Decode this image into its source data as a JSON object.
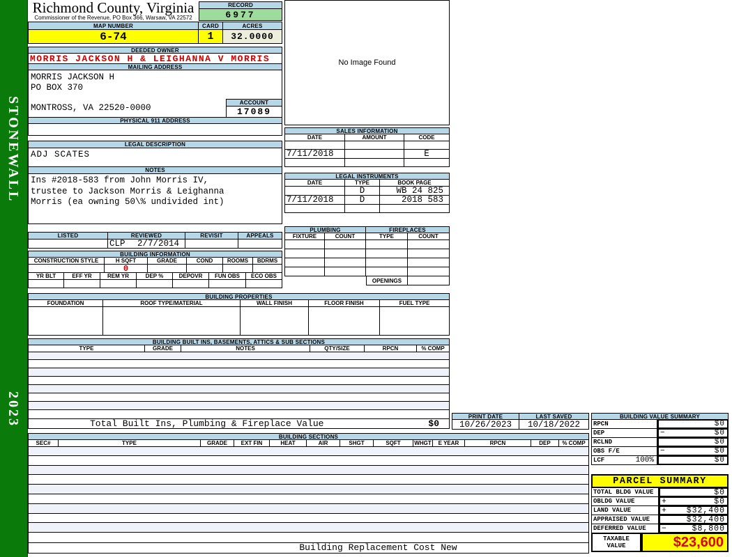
{
  "colors": {
    "sidebar_green": "#0a7b0a",
    "section_header_blue": "#b5d7e8",
    "record_green": "#9ddc9d",
    "highlight_yellow": "#ffff00",
    "acres_cream": "#eeeedd",
    "alert_red": "#cc0000",
    "taxable_red": "#e00000",
    "row_stripe": "#f0f2fa"
  },
  "sidebar": {
    "district": "STONEWALL",
    "year": "2023"
  },
  "header": {
    "county": "Richmond County, Virginia",
    "commissioner_line": "Commissioner of the Revenue, PO Box 366, Warsaw, VA 22572",
    "record_label": "RECORD",
    "record_number": "6977",
    "map_number_label": "MAP NUMBER",
    "map_number": "6-74",
    "card_label": "CARD",
    "card": "1",
    "acres_label": "ACRES",
    "acres": "32.0000"
  },
  "owner": {
    "deeded_owner_label": "DEEDED OWNER",
    "deeded_owner": "MORRIS JACKSON H & LEIGHANNA V MORRIS",
    "mailing_address_label": "MAILING ADDRESS",
    "mailing_lines": [
      "MORRIS JACKSON H",
      "PO BOX 370",
      "MONTROSS, VA 22520-0000"
    ],
    "account_label": "ACCOUNT",
    "account": "17089",
    "physical_address_label": "PHYSICAL 911 ADDRESS"
  },
  "legal": {
    "description_label": "LEGAL DESCRIPTION",
    "description": "ADJ SCATES",
    "notes_label": "NOTES",
    "notes_lines": [
      "Ins #2018-583 from John Morris IV,",
      "trustee to Jackson Morris & Leighanna",
      "Morris (ea owning 50\\% undivided int)"
    ]
  },
  "review": {
    "cols": [
      "LISTED",
      "REVIEWED",
      "REVISIT",
      "APPEALS"
    ],
    "reviewed_by": "CLP",
    "reviewed_date": "2/7/2014"
  },
  "building_information": {
    "title": "BUILDING INFORMATION",
    "cols_row1": [
      "CONSTRUCTION STYLE",
      "H SQFT",
      "GRADE",
      "COND",
      "ROOMS",
      "BDRMS"
    ],
    "h_sqft": "0",
    "cols_row2": [
      "YR BLT",
      "EFF YR",
      "REM YR",
      "DEP %",
      "DEPOVR",
      "FUN OBS",
      "ECO OBS"
    ]
  },
  "image_panel": {
    "placeholder": "No Image Found"
  },
  "sales": {
    "title": "SALES INFORMATION",
    "cols": [
      "DATE",
      "AMOUNT",
      "CODE"
    ],
    "rows": [
      [
        "",
        "",
        ""
      ],
      [
        "7/11/2018",
        "",
        "E"
      ],
      [
        "",
        "",
        ""
      ]
    ]
  },
  "instruments": {
    "title": "LEGAL INSTRUMENTS",
    "cols": [
      "DATE",
      "TYPE",
      "BOOK PAGE"
    ],
    "rows": [
      [
        "",
        "D",
        "WB 24 825"
      ],
      [
        "7/11/2018",
        "D",
        "2018 583"
      ],
      [
        "",
        "",
        ""
      ]
    ]
  },
  "plumbing": {
    "title": "PLUMBING",
    "cols": [
      "FIXTURE",
      "COUNT"
    ]
  },
  "fireplaces": {
    "title": "FIREPLACES",
    "cols": [
      "TYPE",
      "COUNT"
    ],
    "openings_label": "OPENINGS"
  },
  "building_properties": {
    "title": "BUILDING PROPERTIES",
    "cols": [
      "FOUNDATION",
      "ROOF TYPE/MATERIAL",
      "WALL FINISH",
      "FLOOR FINISH",
      "FUEL TYPE"
    ]
  },
  "built_ins": {
    "title": "BUILDING BUILT INS, BASEMENTS, ATTICS & SUB SECTIONS",
    "cols": [
      "TYPE",
      "GRADE",
      "NOTES",
      "QTY/SIZE",
      "RPCN",
      "% COMP"
    ],
    "total_label": "Total Built Ins, Plumbing & Fireplace Value",
    "total_value": "$0"
  },
  "print_info": {
    "print_date_label": "PRINT DATE",
    "print_date": "10/26/2023",
    "last_saved_label": "LAST SAVED",
    "last_saved": "10/18/2022"
  },
  "building_value_summary": {
    "title": "BUILDING VALUE SUMMARY",
    "rows": [
      {
        "label": "RPCN",
        "op": "",
        "value": "$0"
      },
      {
        "label": "DEP",
        "op": "−",
        "value": "$0"
      },
      {
        "label": "RCLND",
        "op": "",
        "value": "$0"
      },
      {
        "label": "OBS F/E",
        "op": "−",
        "value": "$0"
      },
      {
        "label": "LCF",
        "pct": "100%",
        "op": "",
        "value": "$0"
      }
    ]
  },
  "building_sections": {
    "title": "BUILDING SECTIONS",
    "cols": [
      "SEC#",
      "TYPE",
      "GRADE",
      "EXT FIN",
      "HEAT",
      "AIR",
      "SHGT",
      "SQFT",
      "WHGT",
      "E YEAR",
      "RPCN",
      "DEP",
      "% COMP"
    ],
    "footer": "Building Replacement Cost New"
  },
  "parcel_summary": {
    "title": "PARCEL SUMMARY",
    "rows": [
      {
        "label": "TOTAL BLDG VALUE",
        "op": "",
        "value": "$0"
      },
      {
        "label": "OBLDG VALUE",
        "op": "+",
        "value": "$0"
      },
      {
        "label": "LAND VALUE",
        "op": "+",
        "value": "$32,400"
      },
      {
        "label": "APPRAISED VALUE",
        "op": "",
        "value": "$32,400"
      },
      {
        "label": "DEFERRED VALUE",
        "op": "−",
        "value": "$8,800"
      }
    ],
    "taxable_label_1": "TAXABLE",
    "taxable_label_2": "VALUE",
    "taxable_value": "$23,600"
  }
}
